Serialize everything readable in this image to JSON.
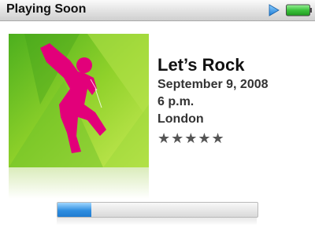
{
  "titlebar": {
    "title": "Playing Soon",
    "icons": [
      "play-icon",
      "battery-icon"
    ],
    "battery_color": "#3cc23c"
  },
  "artwork": {
    "description_icon": "dancer-silhouette-icon",
    "colors": {
      "background": "#7cc31e",
      "figure": "#e2007a"
    }
  },
  "now_playing": {
    "song": "Let’s Rock",
    "date": "September 9, 2008",
    "time": "6 p.m.",
    "location": "London",
    "rating_stars": 5,
    "rating_display": "★★★★★"
  },
  "progress": {
    "fraction": 0.17,
    "accent": "#2f8ee0"
  }
}
